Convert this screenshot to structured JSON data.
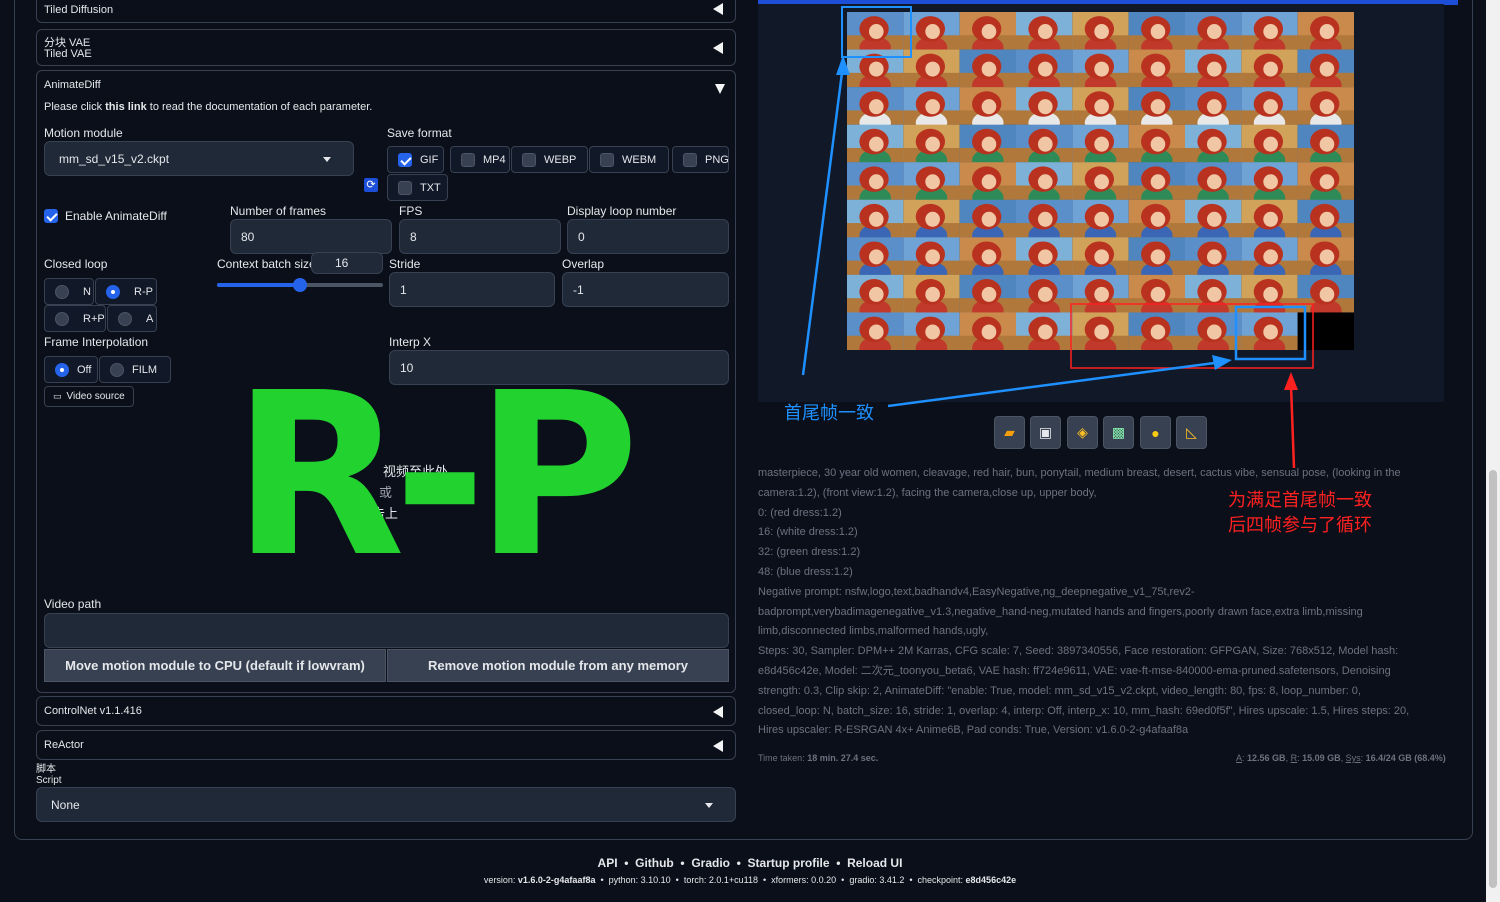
{
  "accordions": {
    "tiled_diffusion": "Tiled Diffusion",
    "tiled_vae_cn": "分块 VAE",
    "tiled_vae_en": "Tiled VAE",
    "animatediff": "AnimateDiff",
    "controlnet": "ControlNet v1.1.416",
    "reactor": "ReActor"
  },
  "animatediff": {
    "doc_prefix": "Please click ",
    "doc_link": "this link",
    "doc_suffix": " to read the documentation of each parameter.",
    "motion_module_label": "Motion module",
    "motion_module_value": "mm_sd_v15_v2.ckpt",
    "save_format_label": "Save format",
    "save_formats": [
      {
        "label": "GIF",
        "checked": true
      },
      {
        "label": "MP4",
        "checked": false
      },
      {
        "label": "WEBP",
        "checked": false
      },
      {
        "label": "WEBM",
        "checked": false
      },
      {
        "label": "PNG",
        "checked": false
      },
      {
        "label": "TXT",
        "checked": false
      }
    ],
    "enable_label": "Enable AnimateDiff",
    "frames_label": "Number of frames",
    "frames_value": "80",
    "fps_label": "FPS",
    "fps_value": "8",
    "loop_label": "Display loop number",
    "loop_value": "0",
    "closed_loop_label": "Closed loop",
    "closed_loop_options": [
      "N",
      "R-P",
      "R+P",
      "A"
    ],
    "closed_loop_selected": "R-P",
    "context_label": "Context batch size",
    "context_value": "16",
    "context_slider_fraction": 0.5,
    "stride_label": "Stride",
    "stride_value": "1",
    "overlap_label": "Overlap",
    "overlap_value": "-1",
    "interp_label": "Frame Interpolation",
    "interp_options": [
      "Off",
      "FILM"
    ],
    "interp_selected": "Off",
    "interp_x_label": "Interp X",
    "interp_x_value": "10",
    "video_source_label": "Video source",
    "drop_line1": "视频至此处",
    "drop_line2": "或",
    "drop_line3": "点击上",
    "overlay_text": "R-P",
    "video_path_label": "Video path",
    "video_path_value": "",
    "btn_move": "Move motion module to CPU (default if lowvram)",
    "btn_remove": "Remove motion module from any memory"
  },
  "script": {
    "label_cn": "脚本",
    "label_en": "Script",
    "value": "None"
  },
  "annotations": {
    "first_last_consistent": "首尾帧一致",
    "note_line1": "为满足首尾帧一致",
    "note_line2": "后四帧参与了循环"
  },
  "output_info": {
    "prompt_lines": [
      "masterpiece, 30 year old women, cleavage, red hair, bun, ponytail, medium breast, desert, cactus vibe, sensual pose, (looking in the",
      "camera:1.2), (front view:1.2), facing the camera,close up, upper body,",
      "0: (red dress:1.2)",
      "16: (white dress:1.2)",
      "32: (green dress:1.2)",
      "48: (blue dress:1.2)",
      "Negative prompt: nsfw,logo,text,badhandv4,EasyNegative,ng_deepnegative_v1_75t,rev2-",
      "badprompt,verybadimagenegative_v1.3,negative_hand-neg,mutated hands and fingers,poorly drawn face,extra limb,missing",
      "limb,disconnected limbs,malformed hands,ugly,",
      "Steps: 30, Sampler: DPM++ 2M Karras, CFG scale: 7, Seed: 3897340556, Face restoration: GFPGAN, Size: 768x512, Model hash:",
      "e8d456c42e, Model: 二次元_toonyou_beta6, VAE hash: ff724e9611, VAE: vae-ft-mse-840000-ema-pruned.safetensors, Denoising",
      "strength: 0.3, Clip skip: 2, AnimateDiff: \"enable: True, model: mm_sd_v15_v2.ckpt, video_length: 80, fps: 8, loop_number: 0,",
      "closed_loop: N, batch_size: 16, stride: 1, overlap: 4, interp: Off, interp_x: 10, mm_hash: 69ed0f5f\", Hires upscale: 1.5, Hires steps: 20,",
      "Hires upscaler: R-ESRGAN 4x+ Anime6B, Pad conds: True, Version: v1.6.0-2-g4afaaf8a"
    ],
    "time_prefix": "Time taken: ",
    "time_value": "18 min. 27.4 sec.",
    "mem_a_label": "A",
    "mem_a": "12.56 GB",
    "mem_r_label": "R",
    "mem_r": "15.09 GB",
    "mem_sys_label": "Sys",
    "mem_sys": "16.4/24 GB (68.4%)"
  },
  "toolbar_icons": [
    "folder-icon",
    "save-icon",
    "zip-icon",
    "image-icon",
    "palette-icon",
    "ruler-icon"
  ],
  "footer": {
    "links": [
      "API",
      "Github",
      "Gradio",
      "Startup profile",
      "Reload UI"
    ],
    "version_prefix": "version: ",
    "version": "v1.6.0-2-g4afaaf8a",
    "python": "python: 3.10.10",
    "torch": "torch: 2.0.1+cu118",
    "xformers": "xformers: 0.0.20",
    "gradio": "gradio: 3.41.2",
    "checkpoint_prefix": "checkpoint: ",
    "checkpoint": "e8d456c42e"
  },
  "colors": {
    "accent_blue": "#2563eb",
    "overlay_green": "#22d330",
    "annotation_blue": "#1e90ff",
    "annotation_red": "#ff2020"
  }
}
